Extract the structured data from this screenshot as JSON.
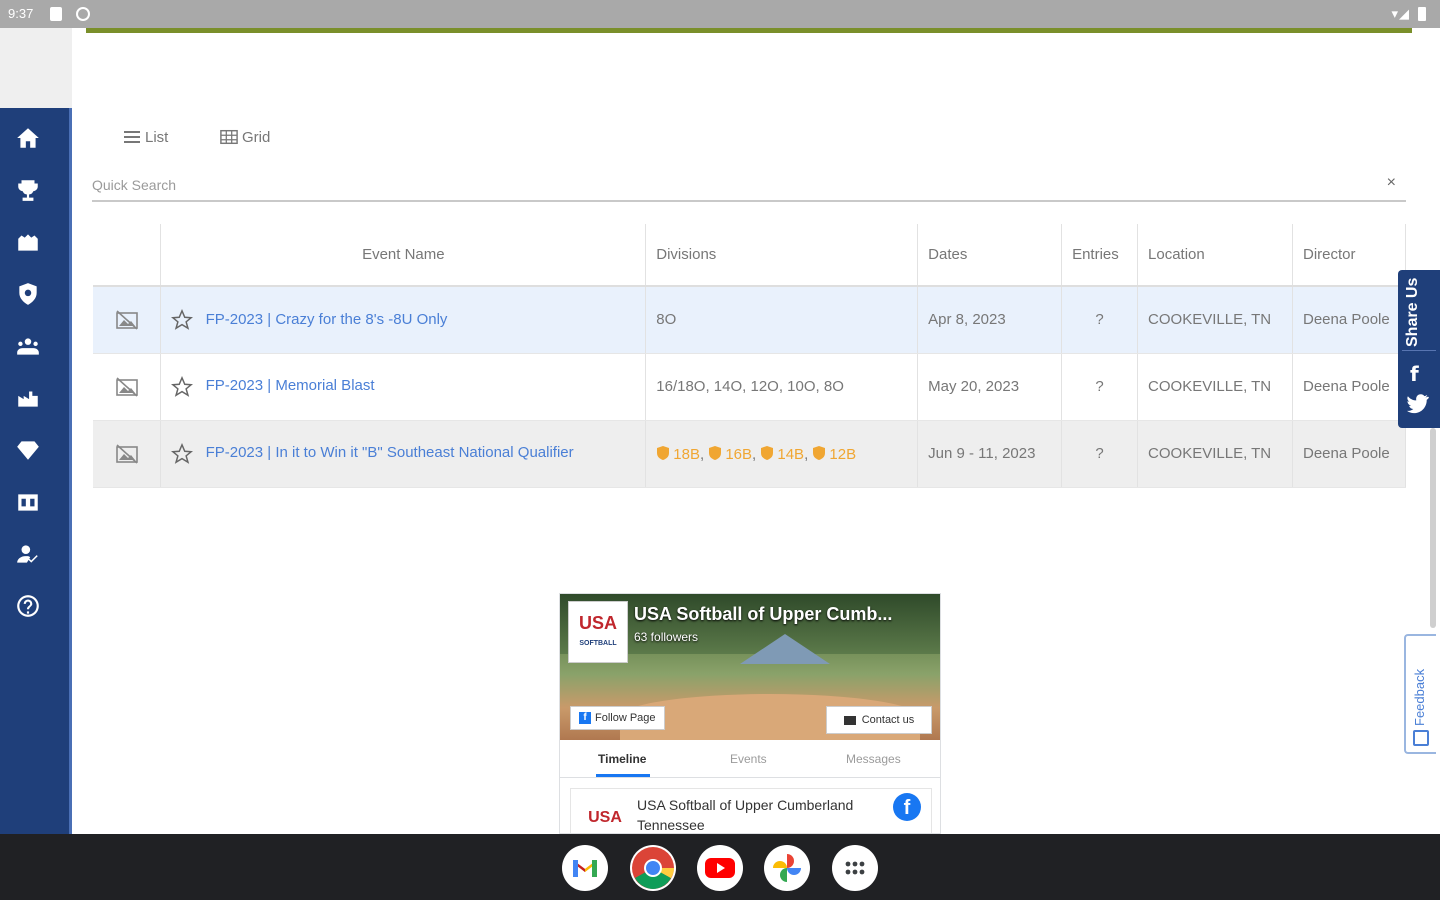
{
  "status_bar": {
    "time": "9:37"
  },
  "view_toggles": {
    "list_label": "List",
    "grid_label": "Grid"
  },
  "search": {
    "placeholder": "Quick Search",
    "clear_glyph": "×"
  },
  "table": {
    "headers": [
      "",
      "Event Name",
      "Divisions",
      "Dates",
      "Entries",
      "Location",
      "Director"
    ],
    "rows": [
      {
        "event_name": "FP-2023 | Crazy for the 8's -8U Only",
        "divisions": "8O",
        "dates": "Apr 8, 2023",
        "entries": "?",
        "location": "COOKEVILLE, TN",
        "director": "Deena Poole",
        "highlighted": true
      },
      {
        "event_name": "FP-2023 | Memorial Blast",
        "divisions": "16/18O, 14O, 12O, 10O, 8O",
        "dates": "May 20, 2023",
        "entries": "?",
        "location": "COOKEVILLE, TN",
        "director": "Deena Poole"
      },
      {
        "event_name": "FP-2023 | In it to Win it \"B\" Southeast National Qualifier",
        "divisions_badges": [
          "18B",
          "16B",
          "14B",
          "12B"
        ],
        "dates": "Jun 9 - 11, 2023",
        "entries": "?",
        "location": "COOKEVILLE, TN",
        "director": "Deena Poole"
      }
    ]
  },
  "share_bar": {
    "label": "Share Us"
  },
  "feedback": {
    "label": "Feedback"
  },
  "facebook_widget": {
    "page_name": "USA Softball of Upper Cumb...",
    "followers": "63 followers",
    "logo_text": "USA",
    "logo_subtext": "SOFTBALL",
    "follow_label": "Follow Page",
    "contact_label": "Contact us",
    "tabs": [
      "Timeline",
      "Events",
      "Messages"
    ],
    "post_title": "USA Softball of Upper Cumberland Tennessee"
  },
  "sidebar": {
    "items": [
      "home-icon",
      "trophy-icon",
      "stadium-icon",
      "shield-icon",
      "teams-icon",
      "factory-icon",
      "diamond-icon",
      "scoreboard-icon",
      "user-check-icon",
      "help-icon"
    ]
  },
  "taskbar": {
    "apps": [
      "gmail-icon",
      "chrome-icon",
      "youtube-icon",
      "photos-icon",
      "app-launcher-icon"
    ]
  },
  "colors": {
    "sidebar": "#1f3f7a",
    "link": "#4a7fd6",
    "accent_green": "#7a8f2a",
    "badge": "#f0a632"
  }
}
